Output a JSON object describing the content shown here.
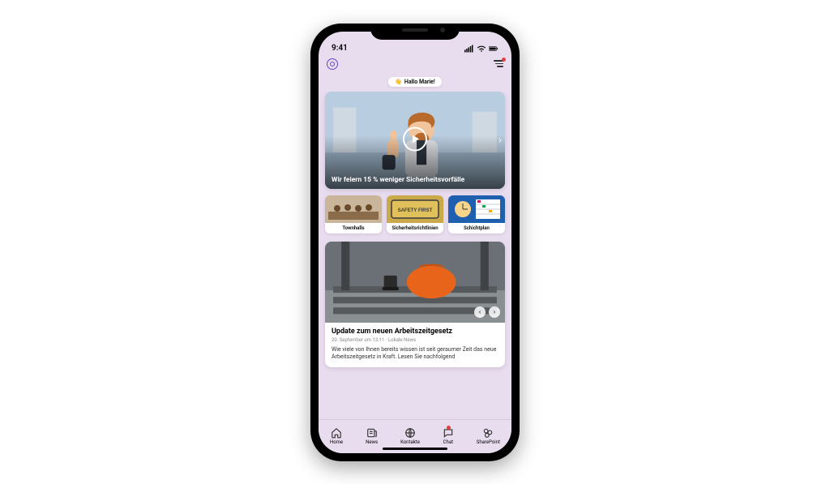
{
  "status": {
    "time": "9:41"
  },
  "greeting": {
    "emoji": "👋",
    "text": "Hallo Marie!"
  },
  "hero": {
    "title": "Wir feiern 15 % weniger Sicherheitsvorfälle",
    "image_alt": "worker-thumbs-up"
  },
  "tiles": [
    {
      "label": "Townhalls",
      "image_alt": "meeting"
    },
    {
      "label": "Sicherheitsrichtlinien",
      "image_alt": "safety-first-mat"
    },
    {
      "label": "Schichtplan",
      "image_alt": "schedule-board"
    }
  ],
  "news_card": {
    "title": "Update zum neuen Arbeitszeitgesetz",
    "meta": "20. September um 13:11 · Lokale News",
    "excerpt": "Wie viele von Ihnen bereits wissen ist seit geraumer Zeit das neue Arbeitszeitgesetz in Kraft. Lesen Sie nachfolgend",
    "image_alt": "orange-hardhat-on-metal"
  },
  "tabs": [
    {
      "label": "Home",
      "icon": "home-icon",
      "badge": false
    },
    {
      "label": "News",
      "icon": "news-icon",
      "badge": false
    },
    {
      "label": "Kontakte",
      "icon": "contacts-icon",
      "badge": false
    },
    {
      "label": "Chat",
      "icon": "chat-icon",
      "badge": true
    },
    {
      "label": "SharePoint",
      "icon": "sharepoint-icon",
      "badge": false
    }
  ]
}
